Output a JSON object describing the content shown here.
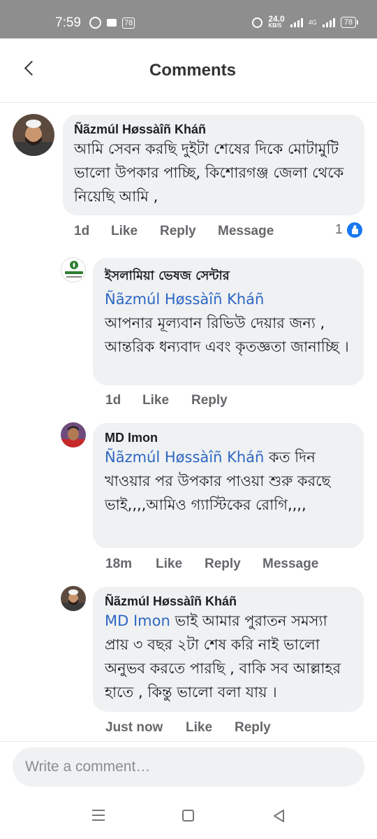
{
  "status_bar": {
    "time": "7:59",
    "notification_badge": "78",
    "network_speed": "24.0",
    "network_speed_unit": "KB/S",
    "network_type": "4G",
    "battery": "78"
  },
  "header": {
    "title": "Comments"
  },
  "comments": [
    {
      "author": "Ñãzmúl Høssàîñ Kháñ",
      "text": "আমি সেবন করছি দুইটা শেষের দিকে মোটামুটি ভালো উপকার পাচ্ছি, কিশোরগঞ্জ জেলা থেকে নিয়েছি আমি ,",
      "time": "1d",
      "like_label": "Like",
      "reply_label": "Reply",
      "message_label": "Message",
      "reaction_count": "1"
    },
    {
      "author": "ইসলামিয়া ভেষজ সেন্টার",
      "mention": "Ñãzmúl Høssàîñ Kháñ",
      "text": "আপনার মূল্যবান রিভিউ দেয়ার জন্য , আন্তরিক ধন্যবাদ এবং কৃতজ্ঞতা জানাচ্ছি ।",
      "time": "1d",
      "like_label": "Like",
      "reply_label": "Reply"
    },
    {
      "author": "MD Imon",
      "mention": "Ñãzmúl Høssàîñ Kháñ",
      "text": " কত দিন খাওয়ার পর উপকার পাওয়া শুরু করছে ভাই,,,,আমিও গ্যাস্টিকের রোগি,,,,",
      "time": "18m",
      "like_label": "Like",
      "reply_label": "Reply",
      "message_label": "Message"
    },
    {
      "author": "Ñãzmúl Høssàîñ Kháñ",
      "mention": "MD Imon",
      "text": " ভাই আমার পুরাতন সমস্যা প্রায় ৩ বছর ২টা শেষ করি নাই ভালো অনুভব করতে পারছি , বাকি সব আল্লাহর হাতে , কিন্তু ভালো বলা যায় ।",
      "time": "Just now",
      "like_label": "Like",
      "reply_label": "Reply"
    }
  ],
  "composer": {
    "placeholder": "Write a comment…"
  },
  "colors": {
    "accent": "#1877f2",
    "mention": "#2d67c3",
    "bubble": "#eff1f3",
    "muted": "#65676b"
  }
}
